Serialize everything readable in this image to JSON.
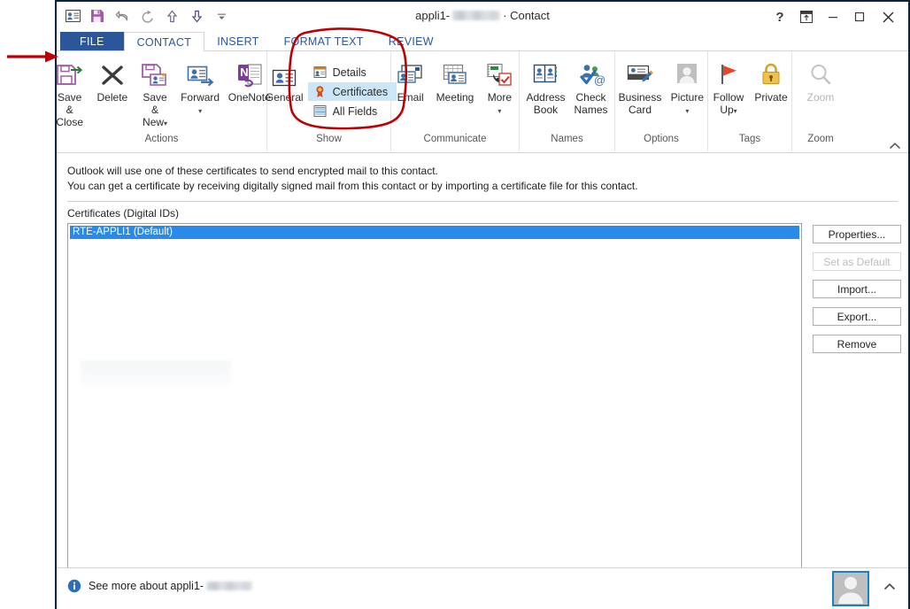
{
  "window": {
    "title_prefix": "appli1-",
    "title_suffix": " · Contact",
    "redacted": true
  },
  "quick_access": [
    {
      "name": "contact-card-icon",
      "tooltip": "Contact"
    },
    {
      "name": "save-icon",
      "tooltip": "Save"
    },
    {
      "name": "undo-icon",
      "tooltip": "Undo"
    },
    {
      "name": "redo-icon",
      "tooltip": "Redo"
    },
    {
      "name": "previous-item-icon",
      "tooltip": "Previous Item"
    },
    {
      "name": "next-item-icon",
      "tooltip": "Next Item"
    },
    {
      "name": "customize-qat-icon",
      "tooltip": "Customize Quick Access Toolbar"
    }
  ],
  "window_controls": {
    "help": "?",
    "ribbon_display": "Ribbon Display Options",
    "minimize": "Minimize",
    "maximize": "Maximize",
    "close": "Close"
  },
  "tabs": [
    {
      "label": "FILE",
      "kind": "file"
    },
    {
      "label": "CONTACT",
      "kind": "active"
    },
    {
      "label": "INSERT",
      "kind": "normal"
    },
    {
      "label": "FORMAT TEXT",
      "kind": "normal"
    },
    {
      "label": "REVIEW",
      "kind": "normal"
    }
  ],
  "ribbon": {
    "groups": [
      {
        "label": "Actions",
        "buttons": [
          {
            "label": "Save &\nClose",
            "label_l1": "Save &",
            "label_l2": "Close",
            "icon": "save-and-close-icon",
            "disabled": false,
            "dropdown": false
          },
          {
            "label": "Delete",
            "label_l1": "Delete",
            "label_l2": "",
            "icon": "delete-icon",
            "disabled": false,
            "dropdown": false
          },
          {
            "label": "Save &\nNew",
            "label_l1": "Save &",
            "label_l2": "New",
            "icon": "save-and-new-icon",
            "disabled": false,
            "dropdown": true
          },
          {
            "label": "Forward",
            "label_l1": "Forward",
            "label_l2": "",
            "icon": "forward-icon",
            "disabled": false,
            "dropdown": true
          },
          {
            "label": "OneNote",
            "label_l1": "OneNote",
            "label_l2": "",
            "icon": "onenote-icon",
            "disabled": false,
            "dropdown": false
          }
        ]
      },
      {
        "label": "Show",
        "general_label": "General",
        "general_icon": "general-contact-icon",
        "menu": [
          {
            "label": "Details",
            "icon": "details-icon",
            "selected": false
          },
          {
            "label": "Certificates",
            "icon": "certificates-icon",
            "selected": true
          },
          {
            "label": "All Fields",
            "icon": "all-fields-icon",
            "selected": false
          }
        ]
      },
      {
        "label": "Communicate",
        "buttons": [
          {
            "label": "Email",
            "label_l1": "Email",
            "label_l2": "",
            "icon": "email-icon",
            "disabled": false,
            "dropdown": false
          },
          {
            "label": "Meeting",
            "label_l1": "Meeting",
            "label_l2": "",
            "icon": "meeting-icon",
            "disabled": false,
            "dropdown": false
          },
          {
            "label": "More",
            "label_l1": "More",
            "label_l2": "",
            "icon": "more-icon",
            "disabled": false,
            "dropdown": true
          }
        ]
      },
      {
        "label": "Names",
        "buttons": [
          {
            "label": "Address Book",
            "label_l1": "Address",
            "label_l2": "Book",
            "icon": "address-book-icon",
            "disabled": false,
            "dropdown": false
          },
          {
            "label": "Check Names",
            "label_l1": "Check",
            "label_l2": "Names",
            "icon": "check-names-icon",
            "disabled": false,
            "dropdown": false
          }
        ]
      },
      {
        "label": "Options",
        "buttons": [
          {
            "label": "Business Card",
            "label_l1": "Business",
            "label_l2": "Card",
            "icon": "business-card-icon",
            "disabled": false,
            "dropdown": false
          },
          {
            "label": "Picture",
            "label_l1": "Picture",
            "label_l2": "",
            "icon": "picture-icon",
            "disabled": false,
            "dropdown": true
          }
        ]
      },
      {
        "label": "Tags",
        "buttons": [
          {
            "label": "Follow Up",
            "label_l1": "Follow",
            "label_l2": "Up",
            "icon": "follow-up-flag-icon",
            "disabled": false,
            "dropdown": true
          },
          {
            "label": "Private",
            "label_l1": "Private",
            "label_l2": "",
            "icon": "private-lock-icon",
            "disabled": false,
            "dropdown": false
          }
        ]
      },
      {
        "label": "Zoom",
        "buttons": [
          {
            "label": "Zoom",
            "label_l1": "Zoom",
            "label_l2": "",
            "icon": "zoom-magnifier-icon",
            "disabled": true,
            "dropdown": false
          }
        ]
      }
    ],
    "collapse_tooltip": "Collapse the Ribbon"
  },
  "content": {
    "info_line_1": "Outlook will use one of these certificates to send encrypted mail to this contact.",
    "info_line_2": "You can get a certificate by receiving digitally signed mail from this contact or by importing a certificate file for this contact.",
    "list_label": "Certificates (Digital IDs)",
    "certificates": [
      {
        "name": "RTE-APPLI1 (Default)",
        "selected": true
      }
    ],
    "buttons": [
      {
        "label": "Properties...",
        "name": "properties-button",
        "disabled": false
      },
      {
        "label": "Set as Default",
        "name": "set-as-default-button",
        "disabled": true
      },
      {
        "label": "Import...",
        "name": "import-button",
        "disabled": false
      },
      {
        "label": "Export...",
        "name": "export-button",
        "disabled": false
      },
      {
        "label": "Remove",
        "name": "remove-button",
        "disabled": false
      }
    ]
  },
  "status": {
    "see_more_prefix": "See more about appli1-",
    "info_icon": "info-icon",
    "avatar_icon": "contact-avatar",
    "expand_icon": "chevron-up-icon"
  },
  "annotations": {
    "arrow_color": "#c00000",
    "ellipse_color": "#c00000",
    "arrow_name": "red-annotation-arrow",
    "ellipse_name": "red-annotation-ellipse"
  },
  "colors": {
    "accent_blue": "#2b579a",
    "file_tab": "#2b579a",
    "selection_blue": "#2a8aea",
    "menu_highlight": "#cde6f7",
    "annotation_red": "#c00000"
  }
}
